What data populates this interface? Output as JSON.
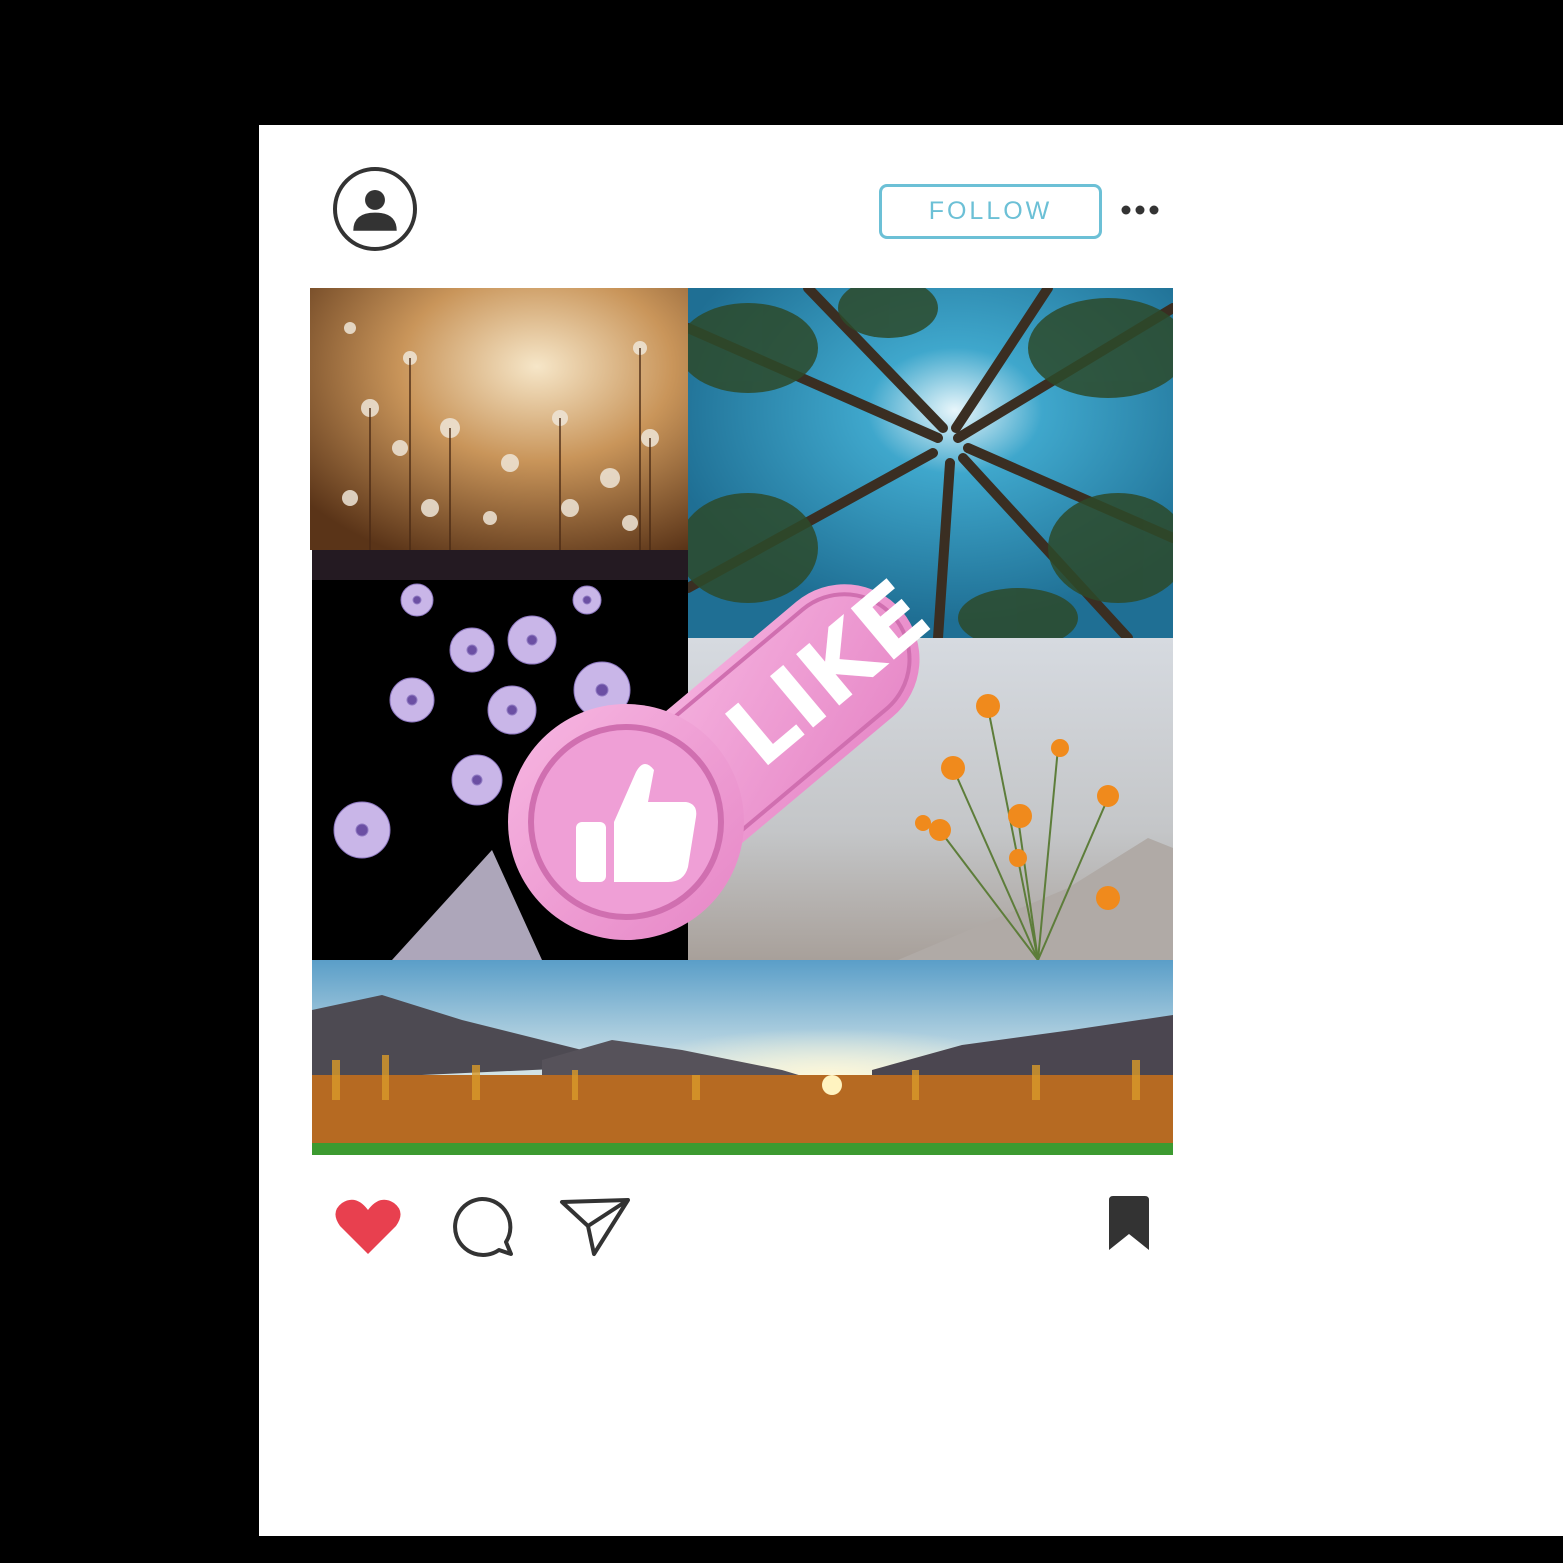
{
  "post": {
    "follow_label": "FOLLOW",
    "like_badge_text": "LIKE"
  },
  "icons": {
    "avatar": "user-avatar-icon",
    "more": "more-options-icon",
    "like": "heart-icon",
    "comment": "comment-icon",
    "share": "send-icon",
    "save": "bookmark-icon",
    "badge": "thumbs-up-icon"
  },
  "colors": {
    "accent": "#6cc0d6",
    "heart": "#e8404f",
    "badge": "#f2a2d8",
    "icon": "#333333"
  }
}
